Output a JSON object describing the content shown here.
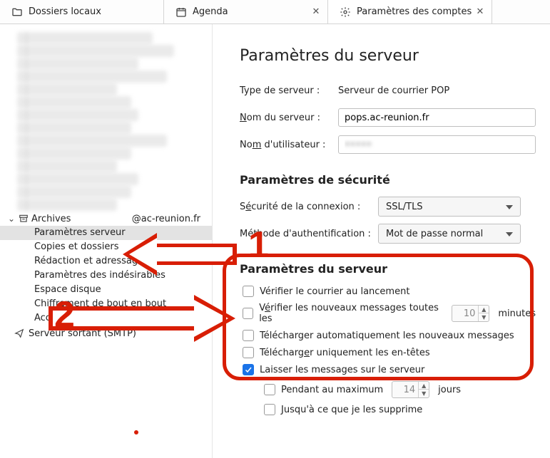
{
  "tabs": {
    "local": "Dossiers locaux",
    "agenda": "Agenda",
    "accounts": "Paramètres des comptes"
  },
  "sidebar": {
    "archiveLabel": "Archives",
    "archiveSuffix": "@ac-reunion.fr",
    "items": [
      "Paramètres serveur",
      "Copies et dossiers",
      "Rédaction et adressage",
      "Paramètres des indésirables",
      "Espace disque",
      "Chiffrement de bout en bout",
      "Accusés de réception"
    ],
    "outgoing": "Serveur sortant (SMTP)"
  },
  "content": {
    "title": "Paramètres du serveur",
    "typeLabel": "Type de serveur :",
    "typeValue": "Serveur de courrier POP",
    "nameLabelPre": "N",
    "nameLabelPost": "om du serveur :",
    "nameValue": "pops.ac-reunion.fr",
    "userLabelPre": "No",
    "userLabelU": "m",
    "userLabelPost": " d'utilisateur :",
    "userValue": "•••••",
    "securityTitle": "Paramètres de sécurité",
    "secLabelPre": "S",
    "secLabelU": "é",
    "secLabelPost": "curité de la connexion :",
    "secValue": "SSL/TLS",
    "authLabel": "Méthode d'authentification :",
    "authValue": "Mot de passe normal",
    "serverParamsTitle": "Paramètres du serveur",
    "chk1": "Vérifier le courrier au lancement",
    "chk2pre": "V",
    "chk2u": "é",
    "chk2post": "rifier les nouveaux messages toutes les",
    "chk2val": "10",
    "chk2unit": "minutes",
    "chk3": "Télécharger automatiquement les nouveaux messages",
    "chk4pre": "Télécharg",
    "chk4u": "e",
    "chk4post": "r uniquement les en-têtes",
    "chk5": "Laisser les messages sur le serveur",
    "chk6": "Pendant au maximum",
    "chk6val": "14",
    "chk6unit": "jours",
    "chk7": "Jusqu'à ce que je les supprime"
  },
  "annotations": {
    "num1": "1",
    "num2": "2"
  }
}
